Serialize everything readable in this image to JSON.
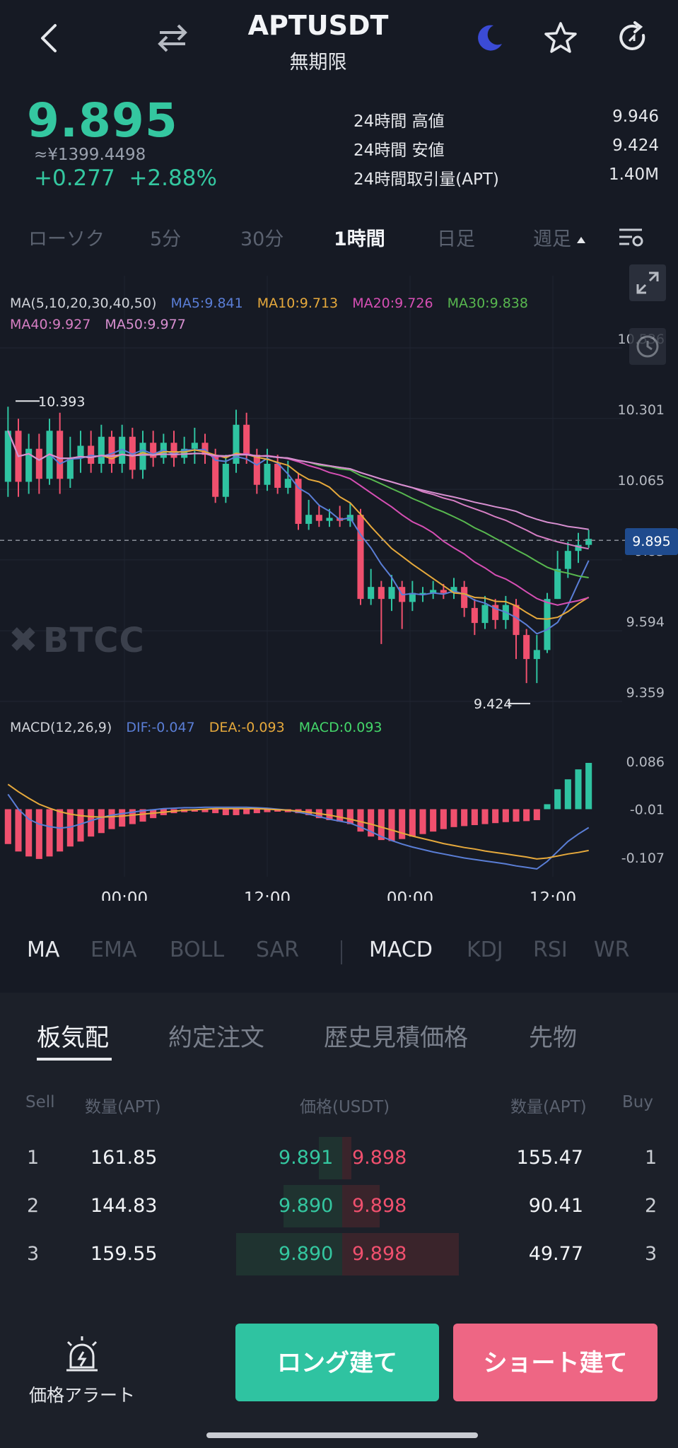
{
  "header": {
    "title": "APTUSDT",
    "subtitle": "無期限"
  },
  "ticker": {
    "price": "9.895",
    "approx": "≈¥1399.4498",
    "change_abs": "+0.277",
    "change_pct": "+2.88%",
    "stats": [
      {
        "label": "24時間 高値",
        "value": "9.946"
      },
      {
        "label": "24時間 安値",
        "value": "9.424"
      },
      {
        "label": "24時間取引量(APT)",
        "value": "1.40M"
      }
    ]
  },
  "period_tabs": [
    "ローソク",
    "5分",
    "30分",
    "1時間",
    "日足",
    "週足"
  ],
  "period_active": "1時間",
  "ma_legend": {
    "label": "MA(5,10,20,30,40,50)",
    "items": [
      {
        "text": "MA5:9.841",
        "color": "#5a7ed6"
      },
      {
        "text": "MA10:9.713",
        "color": "#e6a93c"
      },
      {
        "text": "MA20:9.726",
        "color": "#d64fb4"
      },
      {
        "text": "MA30:9.838",
        "color": "#58b84f"
      },
      {
        "text": "MA40:9.927",
        "color": "#d77ec4"
      },
      {
        "text": "MA50:9.977",
        "color": "#d78fd0"
      }
    ]
  },
  "macd_legend": {
    "label": "MACD(12,26,9)",
    "dif": "DIF:-0.047",
    "dea": "DEA:-0.093",
    "macd": "MACD:0.093"
  },
  "watermark": "BTCC",
  "chart_data": {
    "type": "candlestick",
    "price_axis": [
      "10.536",
      "10.301",
      "10.065",
      "9.83",
      "9.594",
      "9.359"
    ],
    "macd_axis": [
      "0.086",
      "-0.01",
      "-0.107"
    ],
    "time_axis": [
      "00:00",
      "12:00",
      "00:00",
      "12:00"
    ],
    "last_price": "9.895",
    "high_label": "10.393",
    "low_label": "9.424",
    "ylim": [
      9.359,
      10.536
    ],
    "candles": [
      [
        10.09,
        10.26,
        10.34,
        10.04
      ],
      [
        10.26,
        10.09,
        10.3,
        10.04
      ],
      [
        10.09,
        10.2,
        10.25,
        10.05
      ],
      [
        10.2,
        10.1,
        10.25,
        10.05
      ],
      [
        10.1,
        10.26,
        10.3,
        10.08
      ],
      [
        10.26,
        10.1,
        10.32,
        10.05
      ],
      [
        10.1,
        10.17,
        10.24,
        10.07
      ],
      [
        10.17,
        10.21,
        10.26,
        10.12
      ],
      [
        10.21,
        10.15,
        10.26,
        10.12
      ],
      [
        10.15,
        10.24,
        10.28,
        10.12
      ],
      [
        10.24,
        10.15,
        10.26,
        10.12
      ],
      [
        10.15,
        10.24,
        10.28,
        10.12
      ],
      [
        10.24,
        10.13,
        10.27,
        10.1
      ],
      [
        10.13,
        10.22,
        10.26,
        10.1
      ],
      [
        10.22,
        10.17,
        10.26,
        10.14
      ],
      [
        10.17,
        10.22,
        10.25,
        10.15
      ],
      [
        10.22,
        10.17,
        10.26,
        10.14
      ],
      [
        10.17,
        10.2,
        10.24,
        10.15
      ],
      [
        10.2,
        10.22,
        10.27,
        10.15
      ],
      [
        10.22,
        10.18,
        10.25,
        10.15
      ],
      [
        10.18,
        10.04,
        10.2,
        10.02
      ],
      [
        10.04,
        10.15,
        10.18,
        10.02
      ],
      [
        10.15,
        10.28,
        10.33,
        10.12
      ],
      [
        10.28,
        10.18,
        10.32,
        10.15
      ],
      [
        10.18,
        10.08,
        10.2,
        10.05
      ],
      [
        10.08,
        10.15,
        10.2,
        10.06
      ],
      [
        10.15,
        10.07,
        10.18,
        10.05
      ],
      [
        10.07,
        10.1,
        10.16,
        10.05
      ],
      [
        10.1,
        9.95,
        10.12,
        9.93
      ],
      [
        9.95,
        9.98,
        10.03,
        9.93
      ],
      [
        9.98,
        9.96,
        10.01,
        9.94
      ],
      [
        9.96,
        9.97,
        10.0,
        9.94
      ],
      [
        9.97,
        9.96,
        10.01,
        9.94
      ],
      [
        9.96,
        9.98,
        10.02,
        9.94
      ],
      [
        9.98,
        9.7,
        10.0,
        9.68
      ],
      [
        9.7,
        9.74,
        9.8,
        9.68
      ],
      [
        9.74,
        9.7,
        9.76,
        9.55
      ],
      [
        9.7,
        9.74,
        9.78,
        9.66
      ],
      [
        9.74,
        9.69,
        9.76,
        9.6
      ],
      [
        9.69,
        9.72,
        9.76,
        9.66
      ],
      [
        9.72,
        9.72,
        9.74,
        9.69
      ],
      [
        9.72,
        9.73,
        9.76,
        9.7
      ],
      [
        9.73,
        9.72,
        9.75,
        9.7
      ],
      [
        9.72,
        9.74,
        9.77,
        9.7
      ],
      [
        9.74,
        9.67,
        9.76,
        9.64
      ],
      [
        9.67,
        9.62,
        9.7,
        9.58
      ],
      [
        9.62,
        9.68,
        9.71,
        9.6
      ],
      [
        9.68,
        9.63,
        9.7,
        9.6
      ],
      [
        9.63,
        9.68,
        9.71,
        9.6
      ],
      [
        9.68,
        9.58,
        9.7,
        9.5
      ],
      [
        9.58,
        9.5,
        9.6,
        9.42
      ],
      [
        9.5,
        9.53,
        9.58,
        9.42
      ],
      [
        9.53,
        9.7,
        9.72,
        9.52
      ],
      [
        9.7,
        9.8,
        9.86,
        9.7
      ],
      [
        9.8,
        9.86,
        9.89,
        9.77
      ],
      [
        9.86,
        9.88,
        9.92,
        9.82
      ],
      [
        9.88,
        9.9,
        9.93,
        9.87
      ]
    ],
    "macd_hist": [
      -0.07,
      -0.085,
      -0.095,
      -0.1,
      -0.095,
      -0.085,
      -0.075,
      -0.065,
      -0.055,
      -0.048,
      -0.04,
      -0.035,
      -0.03,
      -0.025,
      -0.018,
      -0.012,
      -0.008,
      -0.006,
      -0.005,
      -0.006,
      -0.008,
      -0.012,
      -0.012,
      -0.01,
      -0.008,
      -0.006,
      -0.005,
      -0.006,
      -0.008,
      -0.012,
      -0.018,
      -0.022,
      -0.025,
      -0.03,
      -0.045,
      -0.055,
      -0.062,
      -0.064,
      -0.06,
      -0.055,
      -0.05,
      -0.045,
      -0.04,
      -0.036,
      -0.034,
      -0.032,
      -0.03,
      -0.028,
      -0.026,
      -0.025,
      -0.024,
      -0.022,
      0.01,
      0.04,
      0.06,
      0.08,
      0.093
    ],
    "macd_dif": [
      0.02,
      -0.01,
      -0.03,
      -0.04,
      -0.045,
      -0.048,
      -0.046,
      -0.04,
      -0.033,
      -0.027,
      -0.022,
      -0.019,
      -0.016,
      -0.013,
      -0.011,
      -0.009,
      -0.008,
      -0.007,
      -0.007,
      -0.006,
      -0.006,
      -0.006,
      -0.006,
      -0.006,
      -0.007,
      -0.008,
      -0.01,
      -0.012,
      -0.016,
      -0.02,
      -0.025,
      -0.03,
      -0.034,
      -0.038,
      -0.046,
      -0.055,
      -0.065,
      -0.073,
      -0.08,
      -0.086,
      -0.091,
      -0.096,
      -0.1,
      -0.104,
      -0.108,
      -0.111,
      -0.114,
      -0.117,
      -0.12,
      -0.124,
      -0.127,
      -0.13,
      -0.115,
      -0.095,
      -0.075,
      -0.06,
      -0.047
    ],
    "macd_dea": [
      0.04,
      0.025,
      0.012,
      0.0,
      -0.008,
      -0.015,
      -0.02,
      -0.023,
      -0.025,
      -0.026,
      -0.025,
      -0.024,
      -0.022,
      -0.02,
      -0.018,
      -0.016,
      -0.014,
      -0.012,
      -0.011,
      -0.01,
      -0.009,
      -0.009,
      -0.009,
      -0.009,
      -0.009,
      -0.01,
      -0.011,
      -0.012,
      -0.014,
      -0.016,
      -0.019,
      -0.022,
      -0.026,
      -0.03,
      -0.035,
      -0.04,
      -0.046,
      -0.052,
      -0.058,
      -0.064,
      -0.069,
      -0.074,
      -0.079,
      -0.083,
      -0.087,
      -0.09,
      -0.094,
      -0.097,
      -0.1,
      -0.103,
      -0.106,
      -0.11,
      -0.108,
      -0.104,
      -0.1,
      -0.097,
      -0.093
    ]
  },
  "indicator_tabs": [
    "MA",
    "EMA",
    "BOLL",
    "SAR",
    "MACD",
    "KDJ",
    "RSI",
    "WR"
  ],
  "indicator_active": [
    "MA",
    "MACD"
  ],
  "book": {
    "tabs": [
      "板気配",
      "約定注文",
      "歴史見積価格",
      "先物"
    ],
    "active_tab": "板気配",
    "headers": {
      "sell": "Sell",
      "qty_left": "数量(APT)",
      "price": "価格(USDT)",
      "qty_right": "数量(APT)",
      "buy": "Buy"
    },
    "rows": [
      {
        "idx": "1",
        "sell_qty": "161.85",
        "bid": "9.891",
        "ask": "9.898",
        "buy_qty": "155.47",
        "buy_idx": "1",
        "bid_depth": 0.22,
        "ask_depth": 0.08
      },
      {
        "idx": "2",
        "sell_qty": "144.83",
        "bid": "9.890",
        "ask": "9.898",
        "buy_qty": "90.41",
        "buy_idx": "2",
        "bid_depth": 0.55,
        "ask_depth": 0.32
      },
      {
        "idx": "3",
        "sell_qty": "159.55",
        "bid": "9.890",
        "ask": "9.898",
        "buy_qty": "49.77",
        "buy_idx": "3",
        "bid_depth": 1.0,
        "ask_depth": 1.0
      }
    ]
  },
  "bottom": {
    "alert_label": "価格アラート",
    "long_label": "ロング建て",
    "short_label": "ショート建て"
  }
}
